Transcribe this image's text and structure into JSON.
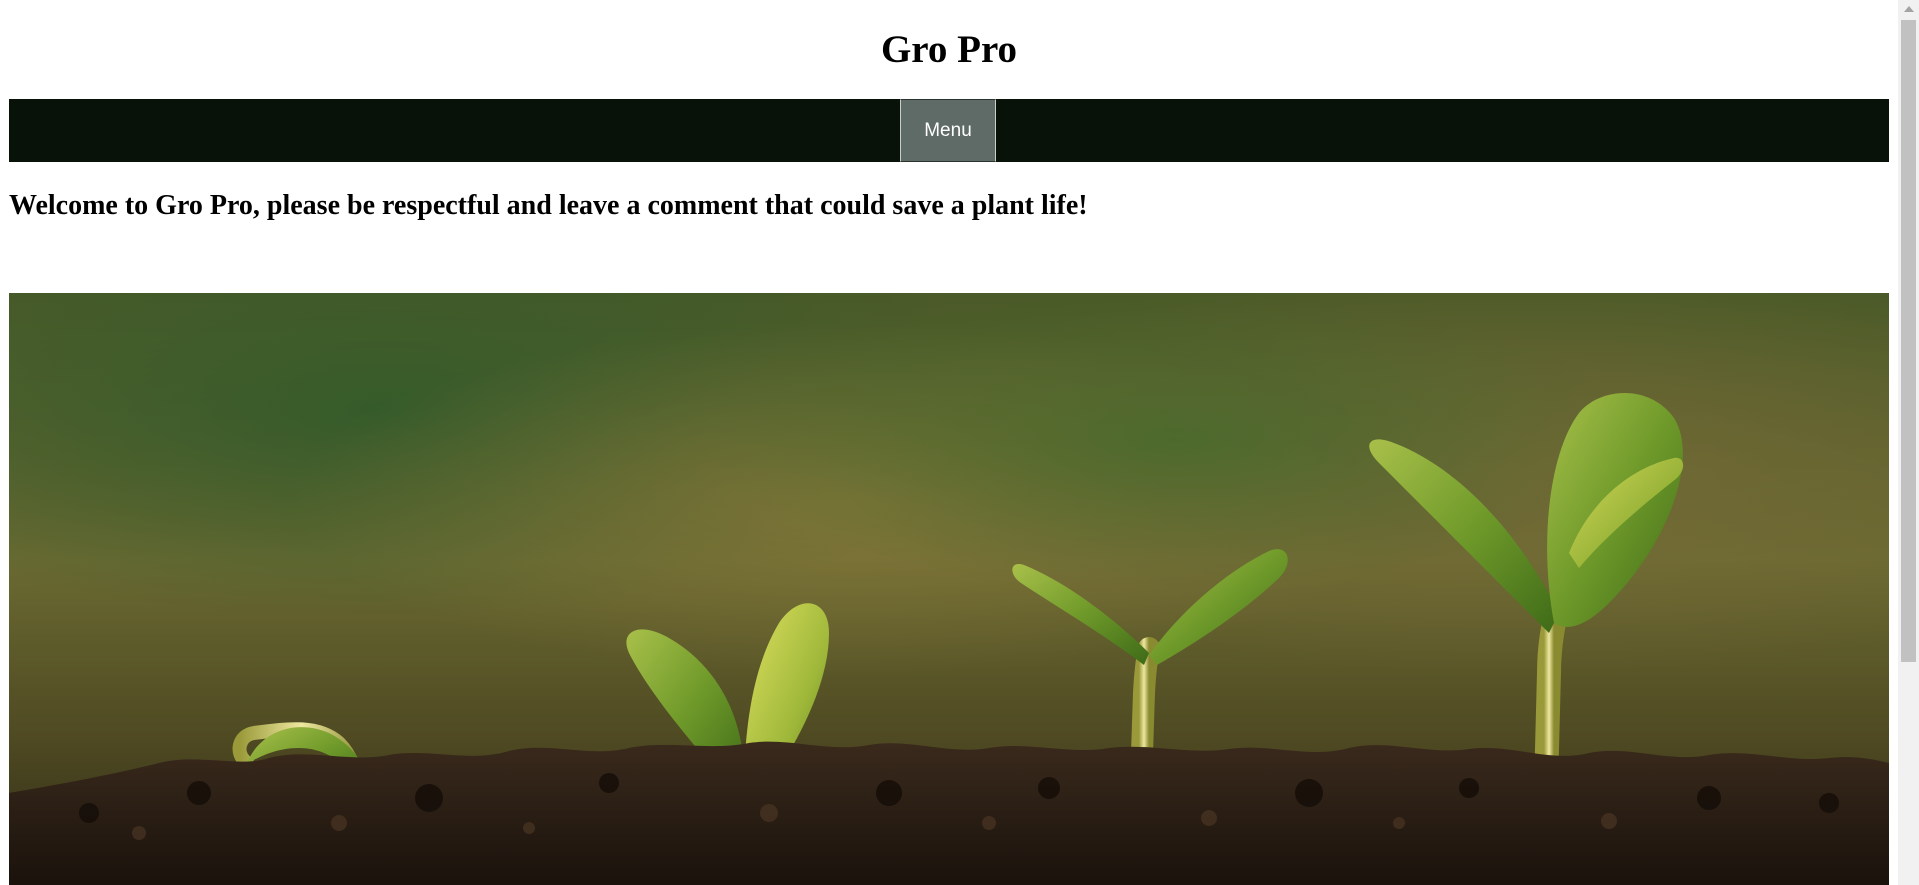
{
  "site": {
    "title": "Gro Pro"
  },
  "nav": {
    "menu_label": "Menu"
  },
  "main": {
    "welcome_text": "Welcome to Gro Pro, please be respectful and leave a comment that could save a plant life!"
  },
  "hero": {
    "image_subject": "seedlings-in-soil"
  },
  "colors": {
    "navbar": "#081208",
    "menu_button": "#5f6b66",
    "text": "#000000",
    "background": "#ffffff"
  }
}
